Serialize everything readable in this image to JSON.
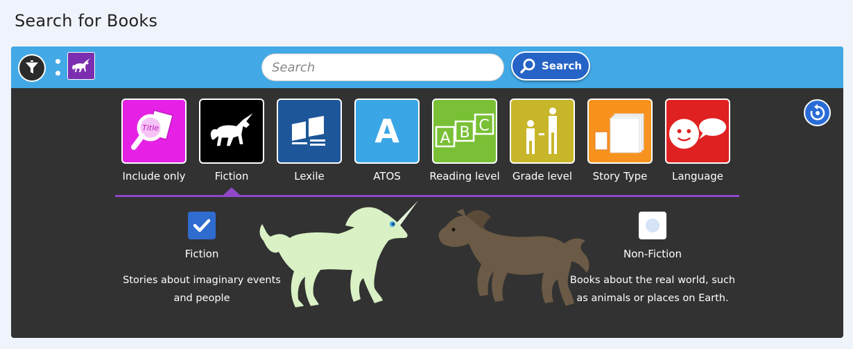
{
  "page": {
    "title": "Search for Books"
  },
  "search": {
    "placeholder": "Search",
    "button_label": "Search"
  },
  "tiles": [
    {
      "label": "Include only",
      "color": "#e521e5",
      "icon": "title-magnifier-icon"
    },
    {
      "label": "Fiction",
      "color": "#000000",
      "icon": "unicorn-icon"
    },
    {
      "label": "Lexile",
      "color": "#1e5799",
      "icon": "books-icon"
    },
    {
      "label": "ATOS",
      "color": "#3aa6e5",
      "icon": "letter-a-icon",
      "glyph": "A"
    },
    {
      "label": "Reading level",
      "color": "#79c036",
      "icon": "abc-blocks-icon",
      "glyph": "ABC"
    },
    {
      "label": "Grade level",
      "color": "#c8b62a",
      "icon": "people-height-icon"
    },
    {
      "label": "Story Type",
      "color": "#f7921e",
      "icon": "book-sizes-icon"
    },
    {
      "label": "Language",
      "color": "#e02121",
      "icon": "speech-face-icon"
    }
  ],
  "fiction_filter": {
    "fiction": {
      "label": "Fiction",
      "description_line1": "Stories about imaginary events",
      "description_line2": "and people",
      "checked": true
    },
    "nonfiction": {
      "label": "Non-Fiction",
      "description_line1": "Books about the real world, such",
      "description_line2": "as animals or places on Earth.",
      "checked": false
    }
  },
  "colors": {
    "header_bar": "#42a9e6",
    "panel_bg": "#323232",
    "active_tab": "#8f48c8",
    "unicorn": "#d9f1c4",
    "horse": "#6b5a45"
  }
}
